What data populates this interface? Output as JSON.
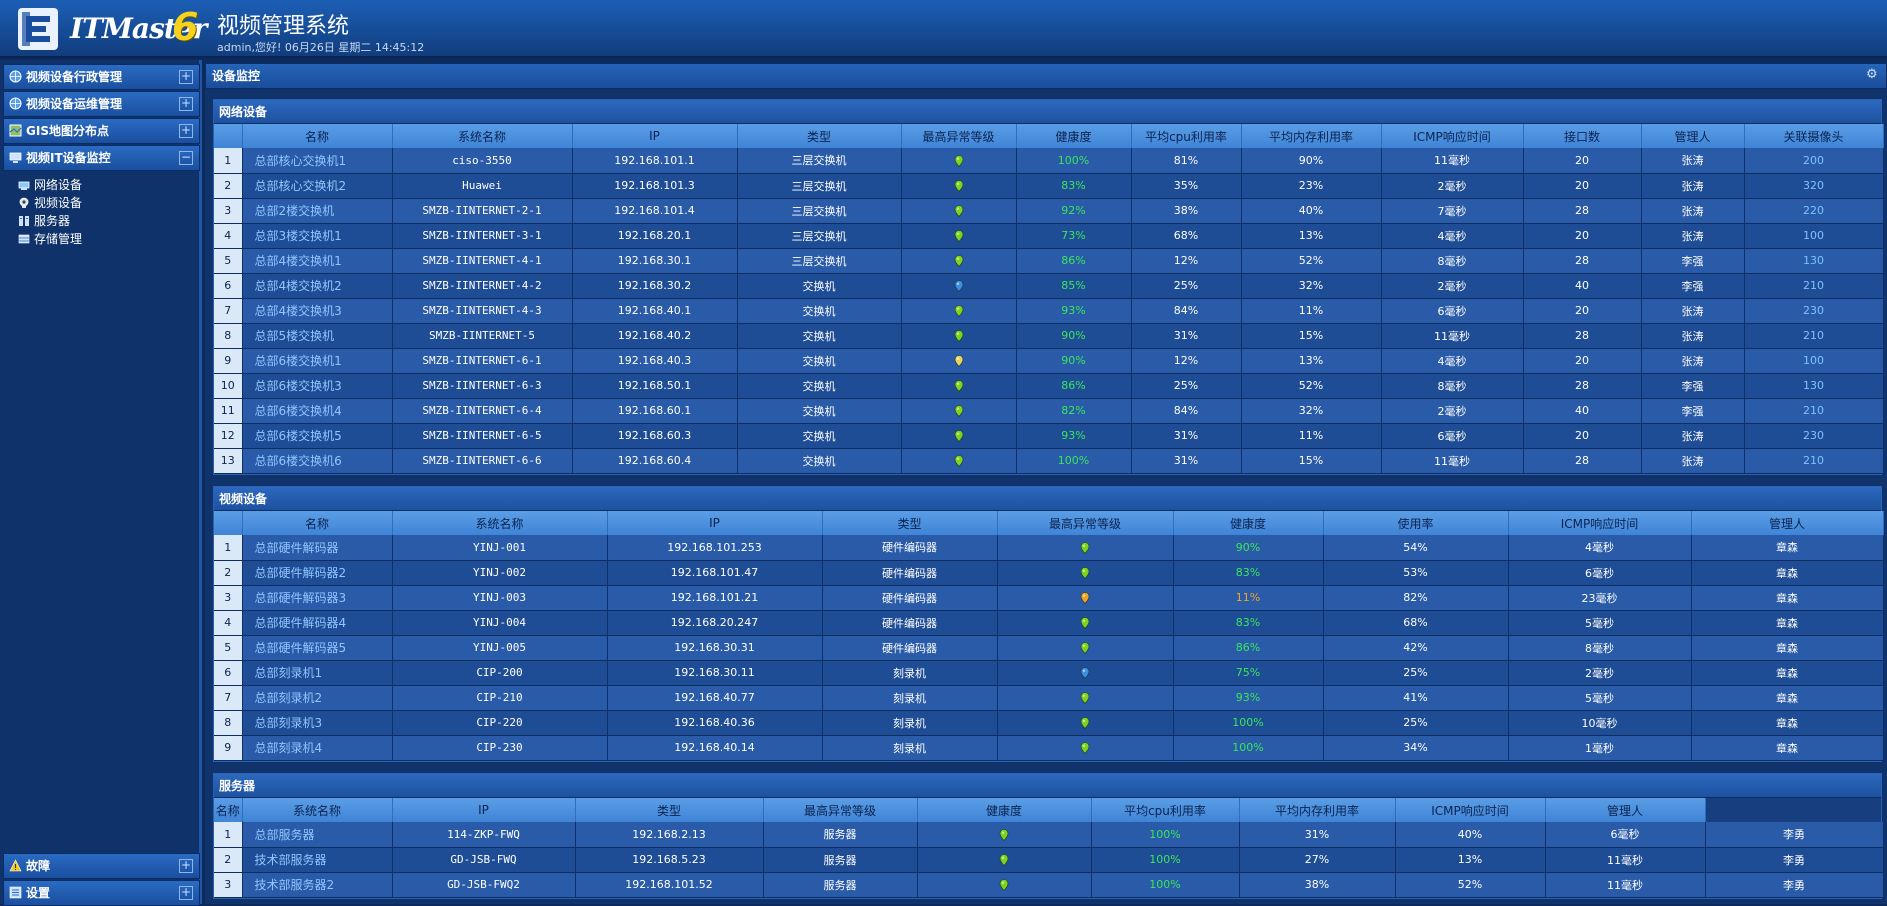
{
  "header": {
    "logo_text": "ITMaster",
    "logo_version": "6",
    "title": "视频管理系统",
    "subtitle": "admin,您好! 06月26日 星期二 14:45:12"
  },
  "sidebar": {
    "items": [
      {
        "label": "视频设备行政管理",
        "toggle": "+"
      },
      {
        "label": "视频设备运维管理",
        "toggle": "+"
      },
      {
        "label": "GIS地图分布点",
        "toggle": "+"
      },
      {
        "label": "视频IT设备监控",
        "toggle": "−"
      }
    ],
    "subitems": [
      "网络设备",
      "视频设备",
      "服务器",
      "存储管理"
    ],
    "bottom_items": [
      {
        "label": "故障",
        "toggle": "+"
      },
      {
        "label": "设置",
        "toggle": "+"
      }
    ]
  },
  "main": {
    "title": "设备监控",
    "network": {
      "title": "网络设备",
      "columns": [
        "名称",
        "系统名称",
        "IP",
        "类型",
        "最高异常等级",
        "健康度",
        "平均cpu利用率",
        "平均内存利用率",
        "ICMP响应时间",
        "接口数",
        "管理人",
        "关联摄像头"
      ],
      "rows": [
        [
          "1",
          "总部核心交换机1",
          "ciso-3550",
          "192.168.101.1",
          "三层交换机",
          "green",
          "100%",
          "81%",
          "90%",
          "11毫秒",
          "20",
          "张涛",
          "200"
        ],
        [
          "2",
          "总部核心交换机2",
          "Huawei",
          "192.168.101.3",
          "三层交换机",
          "green",
          "83%",
          "35%",
          "23%",
          "2毫秒",
          "20",
          "张涛",
          "320"
        ],
        [
          "3",
          "总部2楼交换机",
          "SMZB-IINTERNET-2-1",
          "192.168.101.4",
          "三层交换机",
          "green",
          "92%",
          "38%",
          "40%",
          "7毫秒",
          "28",
          "张涛",
          "220"
        ],
        [
          "4",
          "总部3楼交换机1",
          "SMZB-IINTERNET-3-1",
          "192.168.20.1",
          "三层交换机",
          "green",
          "73%",
          "68%",
          "13%",
          "4毫秒",
          "20",
          "张涛",
          "100"
        ],
        [
          "5",
          "总部4楼交换机1",
          "SMZB-IINTERNET-4-1",
          "192.168.30.1",
          "三层交换机",
          "green",
          "86%",
          "12%",
          "52%",
          "8毫秒",
          "28",
          "李强",
          "130"
        ],
        [
          "6",
          "总部4楼交换机2",
          "SMZB-IINTERNET-4-2",
          "192.168.30.2",
          "交换机",
          "blue",
          "85%",
          "25%",
          "32%",
          "2毫秒",
          "40",
          "李强",
          "210"
        ],
        [
          "7",
          "总部4楼交换机3",
          "SMZB-IINTERNET-4-3",
          "192.168.40.1",
          "交换机",
          "green",
          "93%",
          "84%",
          "11%",
          "6毫秒",
          "20",
          "张涛",
          "230"
        ],
        [
          "8",
          "总部5楼交换机",
          "SMZB-IINTERNET-5",
          "192.168.40.2",
          "交换机",
          "green",
          "90%",
          "31%",
          "15%",
          "11毫秒",
          "28",
          "张涛",
          "210"
        ],
        [
          "9",
          "总部6楼交换机1",
          "SMZB-IINTERNET-6-1",
          "192.168.40.3",
          "交换机",
          "yellow",
          "90%",
          "12%",
          "13%",
          "4毫秒",
          "20",
          "张涛",
          "100"
        ],
        [
          "10",
          "总部6楼交换机3",
          "SMZB-IINTERNET-6-3",
          "192.168.50.1",
          "交换机",
          "green",
          "86%",
          "25%",
          "52%",
          "8毫秒",
          "28",
          "李强",
          "130"
        ],
        [
          "11",
          "总部6楼交换机4",
          "SMZB-IINTERNET-6-4",
          "192.168.60.1",
          "交换机",
          "green",
          "82%",
          "84%",
          "32%",
          "2毫秒",
          "40",
          "李强",
          "210"
        ],
        [
          "12",
          "总部6楼交换机5",
          "SMZB-IINTERNET-6-5",
          "192.168.60.3",
          "交换机",
          "green",
          "93%",
          "31%",
          "11%",
          "6毫秒",
          "20",
          "张涛",
          "230"
        ],
        [
          "13",
          "总部6楼交换机6",
          "SMZB-IINTERNET-6-6",
          "192.168.60.4",
          "交换机",
          "green",
          "100%",
          "31%",
          "15%",
          "11毫秒",
          "28",
          "张涛",
          "210"
        ]
      ]
    },
    "video": {
      "title": "视频设备",
      "columns": [
        "名称",
        "系统名称",
        "IP",
        "类型",
        "最高异常等级",
        "健康度",
        "使用率",
        "ICMP响应时间",
        "管理人"
      ],
      "rows": [
        [
          "1",
          "总部硬件解码器",
          "YINJ-001",
          "192.168.101.253",
          "硬件编码器",
          "green",
          "90%",
          "54%",
          "4毫秒",
          "章森"
        ],
        [
          "2",
          "总部硬件解码器2",
          "YINJ-002",
          "192.168.101.47",
          "硬件编码器",
          "green",
          "83%",
          "53%",
          "6毫秒",
          "章森"
        ],
        [
          "3",
          "总部硬件解码器3",
          "YINJ-003",
          "192.168.101.21",
          "硬件编码器",
          "orange",
          "11%",
          "82%",
          "23毫秒",
          "章森"
        ],
        [
          "4",
          "总部硬件解码器4",
          "YINJ-004",
          "192.168.20.247",
          "硬件编码器",
          "green",
          "83%",
          "68%",
          "5毫秒",
          "章森"
        ],
        [
          "5",
          "总部硬件解码器5",
          "YINJ-005",
          "192.168.30.31",
          "硬件编码器",
          "green",
          "86%",
          "42%",
          "8毫秒",
          "章森"
        ],
        [
          "6",
          "总部刻录机1",
          "CIP-200",
          "192.168.30.11",
          "刻录机",
          "blue",
          "75%",
          "25%",
          "2毫秒",
          "章森"
        ],
        [
          "7",
          "总部刻录机2",
          "CIP-210",
          "192.168.40.77",
          "刻录机",
          "green",
          "93%",
          "41%",
          "5毫秒",
          "章森"
        ],
        [
          "8",
          "总部刻录机3",
          "CIP-220",
          "192.168.40.36",
          "刻录机",
          "green",
          "100%",
          "25%",
          "10毫秒",
          "章森"
        ],
        [
          "9",
          "总部刻录机4",
          "CIP-230",
          "192.168.40.14",
          "刻录机",
          "green",
          "100%",
          "34%",
          "1毫秒",
          "章森"
        ]
      ]
    },
    "servers": {
      "title": "服务器",
      "columns": [
        "名称",
        "系统名称",
        "IP",
        "类型",
        "最高异常等级",
        "健康度",
        "平均cpu利用率",
        "平均内存利用率",
        "ICMP响应时间",
        "管理人"
      ],
      "rows": [
        [
          "1",
          "总部服务器",
          "114-ZKP-FWQ",
          "192.168.2.13",
          "服务器",
          "green",
          "100%",
          "31%",
          "40%",
          "6毫秒",
          "李勇"
        ],
        [
          "2",
          "技术部服务器",
          "GD-JSB-FWQ",
          "192.168.5.23",
          "服务器",
          "green",
          "100%",
          "27%",
          "13%",
          "11毫秒",
          "李勇"
        ],
        [
          "3",
          "技术部服务器2",
          "GD-JSB-FWQ2",
          "192.168.101.52",
          "服务器",
          "green",
          "100%",
          "38%",
          "52%",
          "11毫秒",
          "李勇"
        ]
      ]
    }
  },
  "colors": {
    "status_green": "#7ed321",
    "status_blue": "#3b8fe6",
    "status_yellow": "#e8d066",
    "status_orange": "#f0a22a",
    "health_text": "#39e65b",
    "link_text": "#8fc7ff"
  }
}
